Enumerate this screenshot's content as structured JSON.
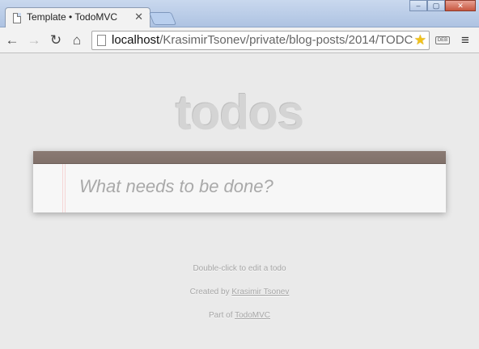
{
  "browser": {
    "tab_title": "Template • TodoMVC",
    "tab_close": "✕",
    "window_buttons": [
      "–",
      "▢",
      "✕"
    ],
    "nav": {
      "back": "←",
      "forward": "→",
      "reload": "↻",
      "home": "⌂"
    },
    "url_host": "localhost",
    "url_path": "/KrasimirTsonev/private/blog-posts/2014/TODC",
    "star": "★",
    "extension_label": "DEB",
    "menu": "≡"
  },
  "app": {
    "title": "todos",
    "new_todo_placeholder": "What needs to be done?",
    "new_todo_value": ""
  },
  "footer": {
    "hint": "Double-click to edit a todo",
    "created_by_prefix": "Created by ",
    "author_link": "Krasimir Tsonev",
    "part_of_prefix": "Part of ",
    "todomvc_link": "TodoMVC"
  },
  "colors": {
    "header_bar": "#867670",
    "title": "#d4d4d4",
    "background": "#eaeaea"
  }
}
